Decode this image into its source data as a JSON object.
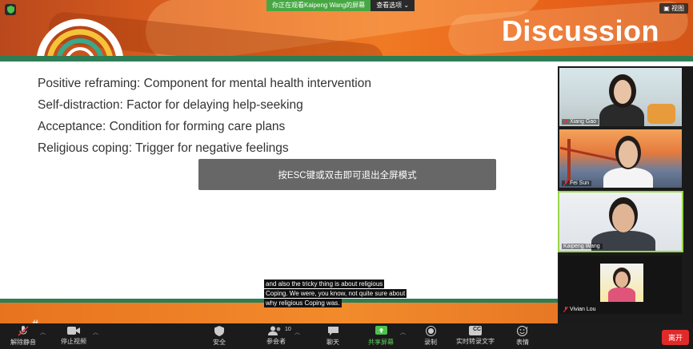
{
  "banner": {
    "sharing_message": "你正在观看Kaipeng Wang的屏幕",
    "view_options": "查看选项 ⌄",
    "view_button": "▣ 视图"
  },
  "slide": {
    "title": "Discussion",
    "bullets": [
      "Positive reframing: Component for mental health intervention",
      "Self-distraction: Factor for delaying help-seeking",
      "Acceptance: Condition for forming care plans",
      "Religious coping: Trigger for negative feelings"
    ],
    "footer_partial": "#"
  },
  "toast": {
    "text": "按ESC键或双击即可退出全屏模式"
  },
  "participants": [
    {
      "name": "Xiang Gao",
      "muted": true
    },
    {
      "name": "Fei Sun",
      "muted": true
    },
    {
      "name": "Kaipeng Wang",
      "muted": false,
      "active_speaker": true
    },
    {
      "name": "Vivian Lou",
      "muted": true
    }
  ],
  "captions": [
    "and also the tricky thing is about religious",
    "Coping. We were, you know, not quite sure about",
    "why religious Coping was."
  ],
  "toolbar": {
    "unmute": "解除静音",
    "stop_video": "停止视频",
    "security": "安全",
    "participants": "参会者",
    "participant_count": "10",
    "chat": "聊天",
    "share_screen": "共享屏幕",
    "record": "录制",
    "transcript": "实时转录文字",
    "reactions": "表情",
    "leave": "离开",
    "cc_badge": "CC"
  },
  "colors": {
    "accent_green": "#47a843",
    "leave_red": "#e02a2a",
    "slide_green": "#2e7d55"
  }
}
